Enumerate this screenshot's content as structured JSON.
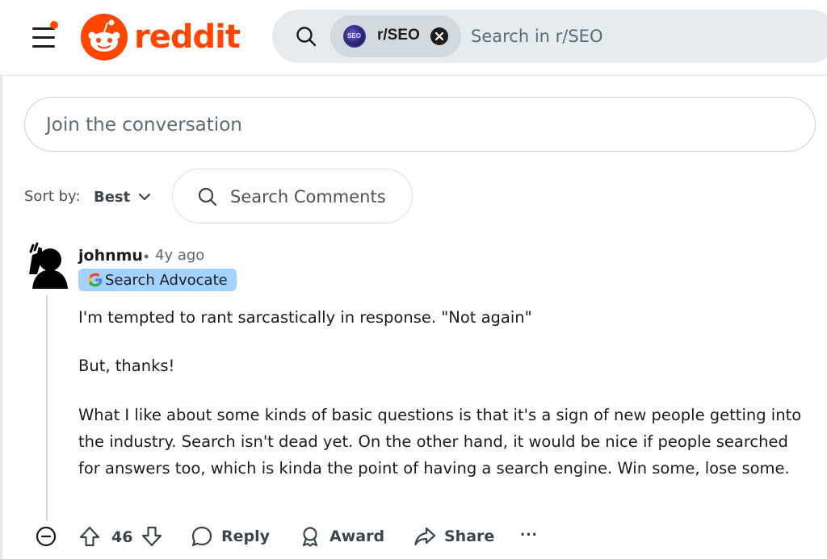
{
  "header": {
    "logo_text": "reddit",
    "search": {
      "scope_label": "r/SEO",
      "scope_avatar_text": "SEO",
      "placeholder": "Search in r/SEO"
    }
  },
  "composer": {
    "placeholder": "Join the conversation"
  },
  "sort": {
    "label": "Sort by:",
    "value": "Best"
  },
  "comment_search": {
    "placeholder": "Search Comments"
  },
  "comment": {
    "author": "johnmu",
    "separator": "•",
    "time": "4y ago",
    "flair": "Search Advocate",
    "paragraphs": [
      "I'm tempted to rant sarcastically in response. \"Not again\"",
      "But, thanks!",
      "What I like about some kinds of basic questions is that it's a sign of new people getting into the industry. Search isn't dead yet. On the other hand, it would be nice if people searched for answers too, which is kinda the point of having a search engine. Win some, lose some."
    ],
    "score": "46",
    "actions": {
      "reply": "Reply",
      "award": "Award",
      "share": "Share",
      "more": "···"
    }
  },
  "colors": {
    "brand": "#ff4500",
    "flair_bg": "#a4d2ff",
    "search_bg": "#e5ebee"
  }
}
